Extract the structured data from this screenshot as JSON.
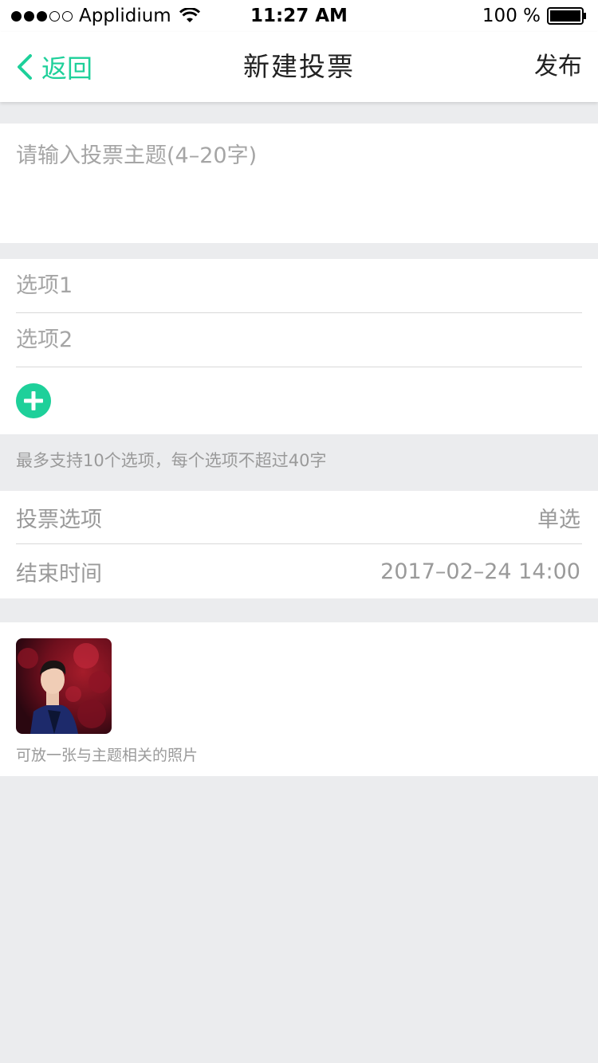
{
  "status_bar": {
    "carrier": "Applidium",
    "time": "11:27 AM",
    "battery": "100 %"
  },
  "nav": {
    "back_label": "返回",
    "title": "新建投票",
    "publish_label": "发布",
    "accent_color": "#1ed09a"
  },
  "topic": {
    "placeholder": "请输入投票主题(4–20字)",
    "value": ""
  },
  "options": [
    {
      "placeholder": "选项1",
      "value": ""
    },
    {
      "placeholder": "选项2",
      "value": ""
    }
  ],
  "add_option_icon": "plus-circle-icon",
  "hint": "最多支持10个选项，每个选项不超过40字",
  "settings": {
    "vote_type": {
      "label": "投票选项",
      "value": "单选"
    },
    "end_time": {
      "label": "结束时间",
      "value": "2017–02–24 14:00"
    }
  },
  "photo": {
    "caption": "可放一张与主题相关的照片"
  }
}
